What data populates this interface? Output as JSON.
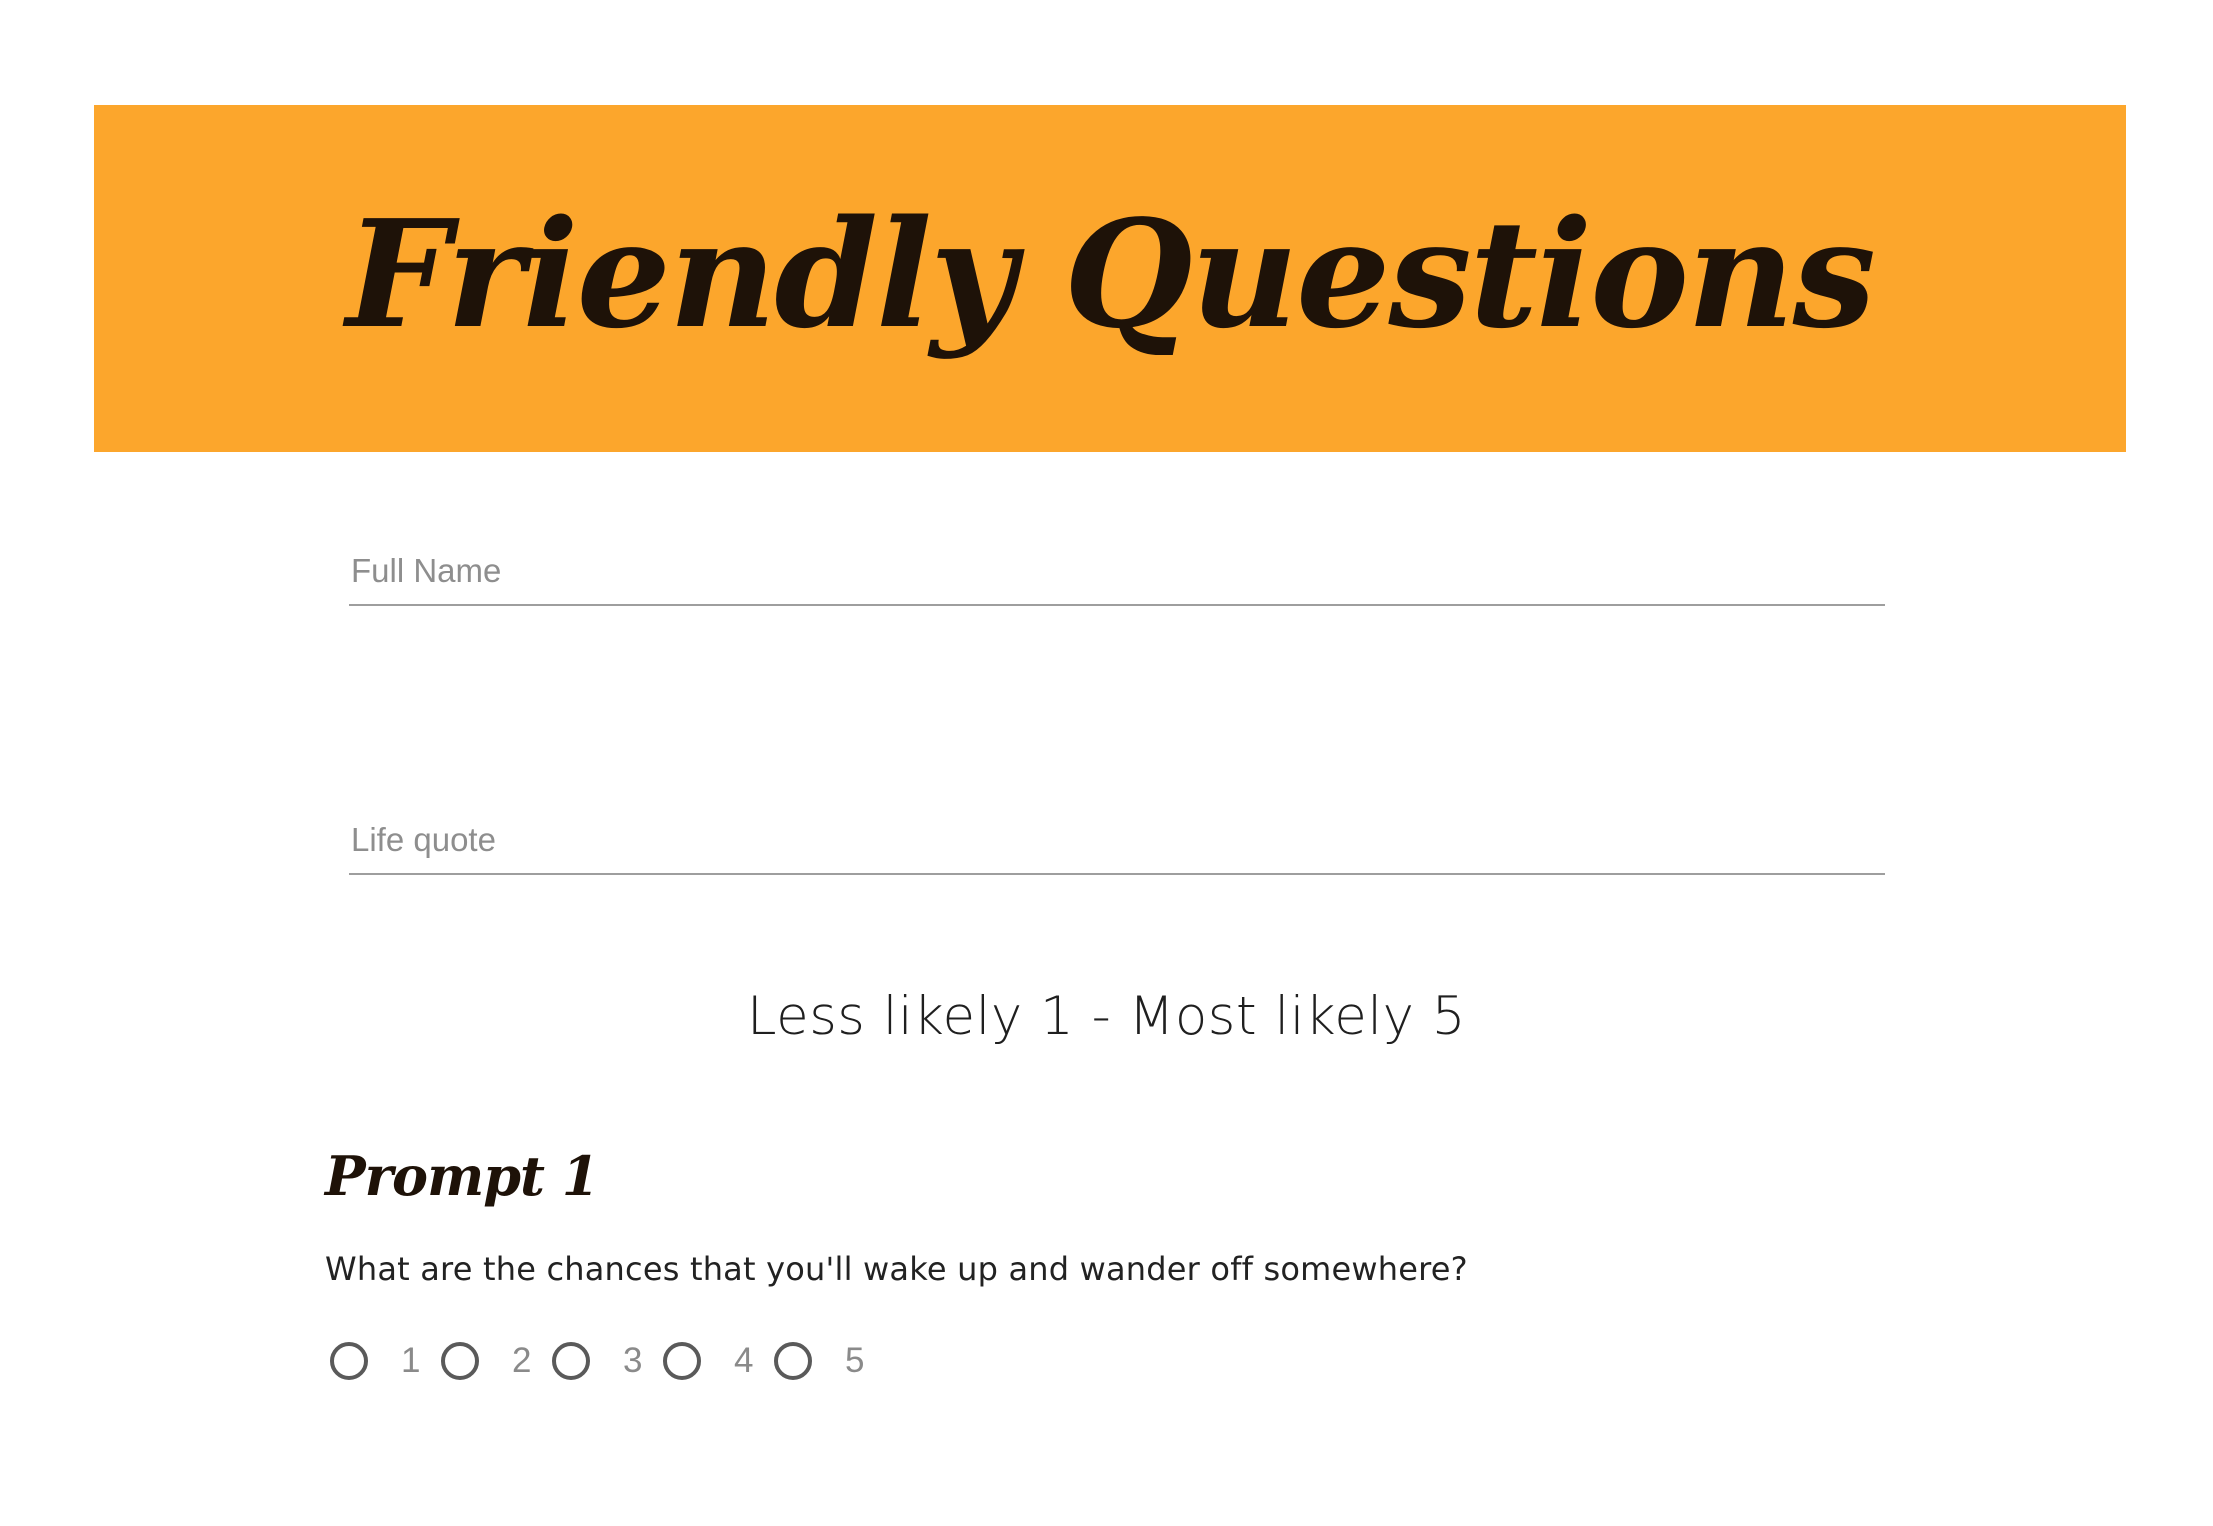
{
  "header": {
    "title": "Friendly Questions",
    "background_color": "#FCA62C"
  },
  "form": {
    "full_name": {
      "placeholder": "Full Name",
      "value": ""
    },
    "life_quote": {
      "placeholder": "Life quote",
      "value": ""
    },
    "scale_heading": "Less likely 1 - Most likely 5",
    "prompts": [
      {
        "title": "Prompt 1",
        "question": "What are the chances that you'll wake up and wander off somewhere?",
        "options": [
          "1",
          "2",
          "3",
          "4",
          "5"
        ],
        "selected": null
      }
    ]
  }
}
